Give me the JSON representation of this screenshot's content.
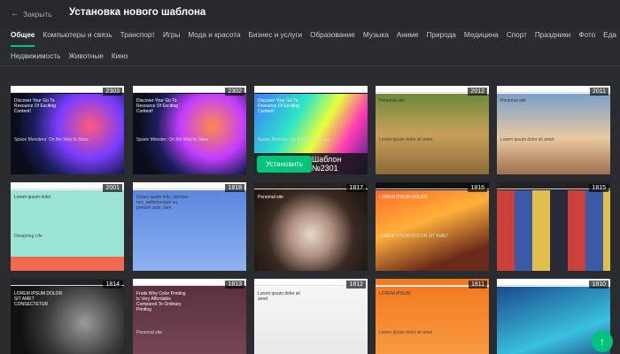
{
  "header": {
    "back_label": "Закрыть",
    "title": "Установка нового шаблона"
  },
  "categories_row1": [
    "Общее",
    "Компьютеры и связь",
    "Транспорт",
    "Игры",
    "Мода и красота",
    "Бизнес и услуги",
    "Образование",
    "Музыка",
    "Аниме",
    "Природа",
    "Медицина",
    "Спорт",
    "Праздники",
    "Фото",
    "Еда"
  ],
  "categories_row2": [
    "Недвижимость",
    "Животные",
    "Кино"
  ],
  "active_category": "Общее",
  "templates": [
    {
      "id": "2303",
      "label": "Discover Your Go To Resource Of Exciting Content!",
      "sub": "Space Monsters: On the Way to Stars"
    },
    {
      "id": "2302",
      "label": "Discover Your Go To Resource Of Exciting Content!",
      "sub": "Space Monster: On the Way to Stars"
    },
    {
      "id": "2301",
      "label": "Discover Your Go To Resource Of Exciting Content!",
      "sub": "Space Monster: On the Way to Stars"
    },
    {
      "id": "2012",
      "label": "Personal site",
      "sub": "Lorem ipsum dolor sit amet"
    },
    {
      "id": "2011",
      "label": "Personal site",
      "sub": "Lorem ipsum dolor sit amet"
    },
    {
      "id": "2001",
      "label": "Lorem ipsum dolor",
      "sub": "Designing Life"
    },
    {
      "id": "1818",
      "label": "Donec quam felis, ultricies nec, pellentesque eu, pretium quis, sem.",
      "sub": ""
    },
    {
      "id": "1817",
      "label": "Personal site",
      "sub": ""
    },
    {
      "id": "1816",
      "label": "LOREM IPSUM DOLOR",
      "sub": "LOREM IPSUM DOLOR SIT AMET"
    },
    {
      "id": "1815",
      "label": "",
      "sub": ""
    },
    {
      "id": "1814",
      "label": "LOREM IPSUM DOLOR SIT AMET CONSECTETUR",
      "sub": ""
    },
    {
      "id": "1813",
      "label": "Fruits Why Color Printing Is Very Affordable Compared To Ordinary Printing",
      "sub": "Personal site"
    },
    {
      "id": "1812",
      "label": "Lorem ipsum dolor sit amet",
      "sub": ""
    },
    {
      "id": "1811",
      "label": "LOREM IPSUM",
      "sub": "Lorem ipsum dolor sit amet"
    },
    {
      "id": "1810",
      "label": "",
      "sub": ""
    }
  ],
  "hover_overlay": {
    "install_label": "Установить",
    "template_name": "Шаблон №2301"
  },
  "fab_icon": "arrow-up-icon",
  "colors": {
    "accent": "#00c47c",
    "background": "#2a2c2f"
  }
}
